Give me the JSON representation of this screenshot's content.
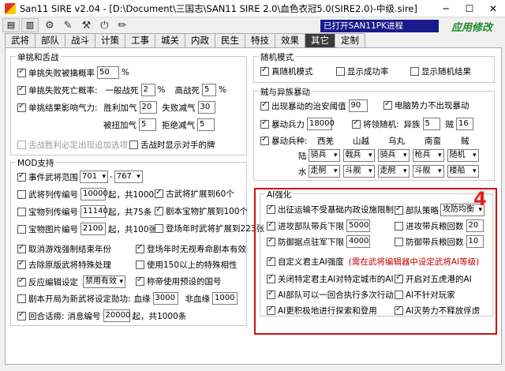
{
  "window": {
    "title": "San11 SIRE v2.04 - [D:\\Document\\三国志\\SAN11 SIRE 2.0\\血色衣冠5.0(SIRE2.0)-中级.sire]",
    "minimize": "─",
    "maximize": "☐",
    "close": "✕"
  },
  "toolbar": {
    "status": "已打开SAN11PK进程",
    "brand": "应用修改"
  },
  "tabs": [
    "武将",
    "部队",
    "战斗",
    "计策",
    "工事",
    "城关",
    "内政",
    "民生",
    "特技",
    "效果",
    "其它",
    "定制"
  ],
  "left": {
    "group1": {
      "title": "单挑和舌战",
      "r1": {
        "label": "单挑失败被擒概率",
        "value": "50",
        "unit": "%"
      },
      "r2": {
        "label": "单挑失败死亡概率:",
        "a": "一般战死",
        "av": "2",
        "au": "%",
        "b": "高战死",
        "bv": "5",
        "bu": "%"
      },
      "r3": {
        "label": "单挑结果影响气力:",
        "a": "胜利加气",
        "av": "20",
        "b": "失败减气",
        "bv": "30"
      },
      "r4": {
        "a": "被扭加气",
        "av": "5",
        "b": "拒绝减气",
        "bv": "5"
      },
      "r5": {
        "a": "舌战胜利必定出现追加选项",
        "b": "舌战时显示对手的牌"
      }
    },
    "group2": {
      "title": "MOD支持",
      "r1": {
        "label": "事件武将范围",
        "from": "701",
        "sep": "-",
        "to": "767"
      },
      "r2": {
        "label": "武将列传编号",
        "value": "10000",
        "suffix": "起，共1000条",
        "b": "古武将扩展到60个"
      },
      "r3": {
        "label": "宝物列传编号",
        "value": "11140",
        "suffix": "起，共75条",
        "b": "剧本宝物扩展到100个"
      },
      "r4": {
        "label": "宝物图片编号",
        "value": "2100",
        "suffix": "起，共100张",
        "b": "登场年时武将扩展到223张"
      },
      "r5": {
        "a": "取消游戏强制结束年份",
        "b": "登场年时无视寿命剧本有效"
      },
      "r6": {
        "a": "去除原版武将特殊处理",
        "b": "使用150以上的特殊相性"
      },
      "r7": {
        "a": "反应编辑设定",
        "sel": "禁用有效",
        "b": "称帝使用预设的国号"
      },
      "r8": {
        "a": "剧本开局为新武将设定勋功:",
        "b": "血缘",
        "bv": "3000",
        "c": "非血缘",
        "cv": "1000"
      },
      "r9": {
        "a": "回合话痨:",
        "b": "消息编号",
        "bv": "20000",
        "suffix": "起，共1000条"
      }
    }
  },
  "right": {
    "g1": {
      "title": "随机模式",
      "a": "真随机模式",
      "b": "显示成功率",
      "c": "显示随机结果"
    },
    "g2": {
      "title": "贼与异族暴动",
      "r1": {
        "a": "出现暴动的治安阈值",
        "av": "90",
        "b": "电脑势力不出现暴动"
      },
      "r2": {
        "a": "暴动兵力",
        "av": "18000",
        "b": "将领随机:",
        "c": "异族",
        "cv": "5",
        "d": "贼",
        "dv": "16"
      },
      "r3": {
        "a": "暴动兵种:",
        "h": [
          "西羌",
          "山越",
          "乌丸",
          "南蛮",
          "贼"
        ]
      },
      "r4": {
        "a": "陆",
        "v": [
          "骑兵",
          "戟兵",
          "骑兵",
          "枪兵",
          "随机"
        ]
      },
      "r5": {
        "a": "水",
        "v": [
          "走舸",
          "斗舰",
          "走舸",
          "斗舰",
          "楼船"
        ]
      }
    },
    "g3": {
      "title": "AI强化",
      "r1": {
        "a": "出征运输不受基础内政设施限制",
        "b": "部队策略",
        "bv": "攻防均衡"
      },
      "r2": {
        "a": "进攻部队带兵下限",
        "av": "5000",
        "b": "进攻带兵粮回数",
        "bv": "20"
      },
      "r3": {
        "a": "防御据点驻军下限",
        "av": "4000",
        "b": "防御带兵粮回数",
        "bv": "10"
      },
      "r4": {
        "a": "自定义君主AI强度",
        "b": "(需在武将编辑器中设定武将AI等级)"
      },
      "r5": {
        "a": "关闭特定君主AI对特定城市的AI",
        "b": "开启对五虎港的AI"
      },
      "r6": {
        "a": "AI部队可以一回合执行多次行动",
        "b": "AI不针对玩家"
      },
      "r7": {
        "a": "AI更积极地进行探索和登用",
        "b": "AI灭势力不释放俘虏"
      }
    },
    "marker": "4"
  },
  "colors": {
    "highlight": "#d01010",
    "status_bg": "#1a1a8c",
    "brand": "#1e8a2a"
  }
}
